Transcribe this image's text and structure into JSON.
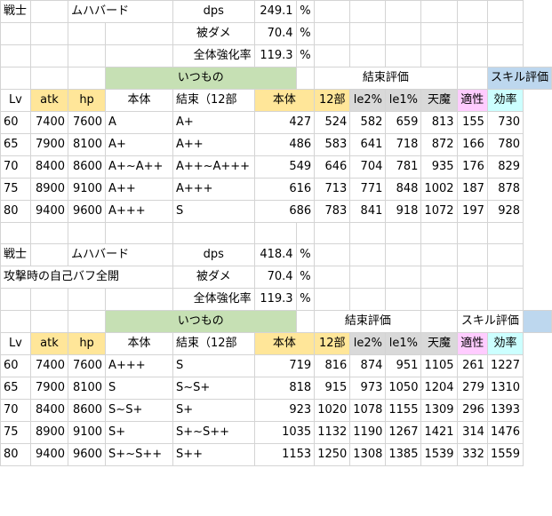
{
  "block1": {
    "top": [
      [
        "戦士",
        "",
        "ムハバード",
        "",
        "dps",
        "249.1",
        "%",
        "",
        "",
        "",
        "",
        "",
        ""
      ],
      [
        "",
        "",
        "",
        "",
        "被ダメ",
        "70.4",
        "%",
        "",
        "",
        "",
        "",
        "",
        ""
      ],
      [
        "",
        "",
        "",
        "",
        "全体強化率",
        "119.3",
        "%",
        "",
        "",
        "",
        "",
        "",
        ""
      ]
    ],
    "groups": {
      "itsumono": "いつもの",
      "kessoku": "結束評価",
      "skill": "スキル評価"
    },
    "headers": [
      "Lv",
      "atk",
      "hp",
      "本体",
      "結束（12部",
      "本体",
      "12部",
      "le2%",
      "le1%",
      "天魔",
      "適性",
      "効率"
    ],
    "rows": [
      [
        "60",
        "7400",
        "7600",
        "A",
        "A+",
        "427",
        "524",
        "582",
        "659",
        "813",
        "155",
        "730"
      ],
      [
        "65",
        "7900",
        "8100",
        "A+",
        "A++",
        "486",
        "583",
        "641",
        "718",
        "872",
        "166",
        "780"
      ],
      [
        "70",
        "8400",
        "8600",
        "A+~A++",
        "A++~A+++",
        "549",
        "646",
        "704",
        "781",
        "935",
        "176",
        "829"
      ],
      [
        "75",
        "8900",
        "9100",
        "A++",
        "A+++",
        "616",
        "713",
        "771",
        "848",
        "1002",
        "187",
        "878"
      ],
      [
        "80",
        "9400",
        "9600",
        "A+++",
        "S",
        "686",
        "783",
        "841",
        "918",
        "1072",
        "197",
        "928"
      ]
    ]
  },
  "block2": {
    "top": [
      [
        "戦士",
        "",
        "ムハバード",
        "",
        "dps",
        "418.4",
        "%",
        "",
        "",
        "",
        "",
        "",
        ""
      ],
      [
        "攻撃時の自己バフ全開",
        "",
        "",
        "",
        "被ダメ",
        "70.4",
        "%",
        "",
        "",
        "",
        "",
        "",
        ""
      ],
      [
        "",
        "",
        "",
        "",
        "全体強化率",
        "119.3",
        "%",
        "",
        "",
        "",
        "",
        "",
        ""
      ]
    ],
    "groups": {
      "itsumono": "いつもの",
      "kessoku": "結束評価",
      "skill": "スキル評価"
    },
    "headers": [
      "Lv",
      "atk",
      "hp",
      "本体",
      "結束（12部",
      "本体",
      "12部",
      "le2%",
      "le1%",
      "天魔",
      "適性",
      "効率"
    ],
    "rows": [
      [
        "60",
        "7400",
        "7600",
        "A+++",
        "S",
        "719",
        "816",
        "874",
        "951",
        "1105",
        "261",
        "1227"
      ],
      [
        "65",
        "7900",
        "8100",
        "S",
        "S~S+",
        "818",
        "915",
        "973",
        "1050",
        "1204",
        "279",
        "1310"
      ],
      [
        "70",
        "8400",
        "8600",
        "S~S+",
        "S+",
        "923",
        "1020",
        "1078",
        "1155",
        "1309",
        "296",
        "1393"
      ],
      [
        "75",
        "8900",
        "9100",
        "S+",
        "S+~S++",
        "1035",
        "1132",
        "1190",
        "1267",
        "1421",
        "314",
        "1476"
      ],
      [
        "80",
        "9400",
        "9600",
        "S+~S++",
        "S++",
        "1153",
        "1250",
        "1308",
        "1385",
        "1539",
        "332",
        "1559"
      ]
    ]
  }
}
